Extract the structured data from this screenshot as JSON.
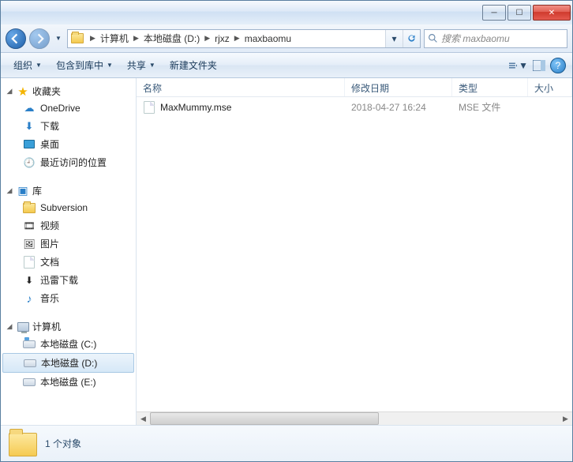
{
  "titlebar": {
    "minimize": "─",
    "maximize": "☐",
    "close": "✕"
  },
  "nav": {
    "crumbs": [
      "计算机",
      "本地磁盘 (D:)",
      "rjxz",
      "maxbaomu"
    ]
  },
  "search": {
    "placeholder": "搜索 maxbaomu"
  },
  "toolbar": {
    "organize": "组织",
    "include": "包含到库中",
    "share": "共享",
    "newfolder": "新建文件夹"
  },
  "sidebar": {
    "favorites": {
      "label": "收藏夹",
      "items": [
        "OneDrive",
        "下载",
        "桌面",
        "最近访问的位置"
      ]
    },
    "libraries": {
      "label": "库",
      "items": [
        "Subversion",
        "视频",
        "图片",
        "文档",
        "迅雷下载",
        "音乐"
      ]
    },
    "computer": {
      "label": "计算机",
      "items": [
        "本地磁盘 (C:)",
        "本地磁盘 (D:)",
        "本地磁盘 (E:)"
      ]
    }
  },
  "columns": {
    "name": "名称",
    "date": "修改日期",
    "type": "类型",
    "size": "大小"
  },
  "files": [
    {
      "name": "MaxMummy.mse",
      "date": "2018-04-27 16:24",
      "type": "MSE 文件",
      "size": ""
    }
  ],
  "status": {
    "text": "1 个对象"
  }
}
